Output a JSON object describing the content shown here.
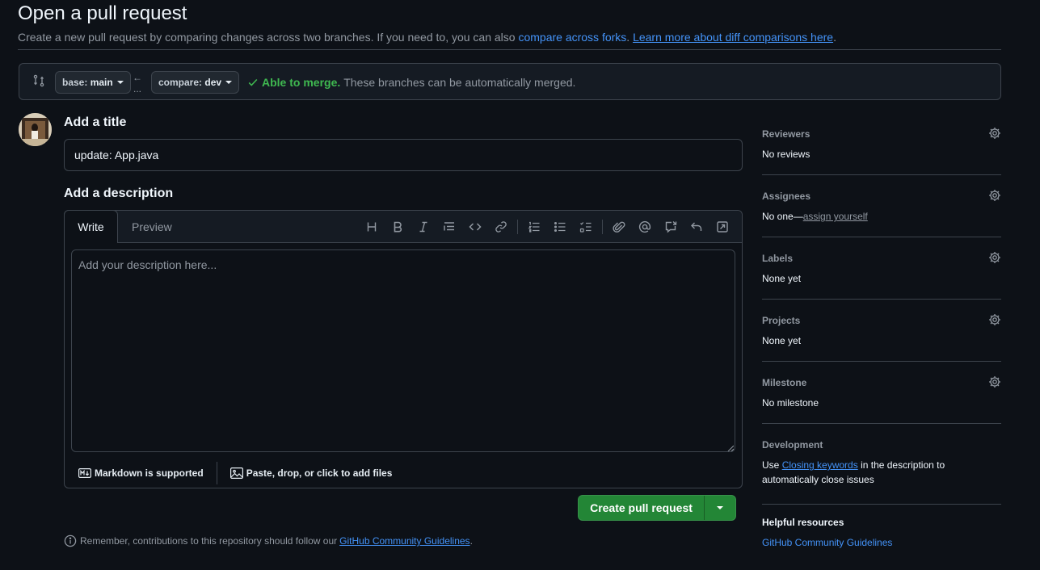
{
  "header": {
    "title": "Open a pull request",
    "subtitle_text": "Create a new pull request by comparing changes across two branches. If you need to, you can also ",
    "compare_forks_link": "compare across forks",
    "subtitle_sep": ".",
    "learn_more_link": "Learn more about diff comparisons here",
    "subtitle_end": "."
  },
  "compare": {
    "base_prefix": "base:",
    "base_branch": "main",
    "compare_prefix": "compare:",
    "compare_branch": "dev",
    "arrow_glyph": "←",
    "ellipsis": "...",
    "merge_ok": "Able to merge.",
    "merge_text": "These branches can be automatically merged."
  },
  "form": {
    "title_label": "Add a title",
    "title_value": "update: App.java",
    "description_label": "Add a description",
    "tabs": [
      "Write",
      "Preview"
    ],
    "description_placeholder": "Add your description here...",
    "markdown_note": "Markdown is supported",
    "files_note": "Paste, drop, or click to add files",
    "submit_label": "Create pull request",
    "remember_text": "Remember, contributions to this repository should follow our",
    "remember_link": "GitHub Community Guidelines",
    "remember_end": "."
  },
  "toolbar_icons": [
    "heading-icon",
    "bold-icon",
    "italic-icon",
    "quote-icon",
    "code-icon",
    "link-icon",
    "ordered-list-icon",
    "unordered-list-icon",
    "task-list-icon",
    "attach-icon",
    "mention-icon",
    "reference-icon",
    "undo-icon",
    "fullscreen-icon"
  ],
  "sidebar": {
    "reviewers": {
      "label": "Reviewers",
      "value": "No reviews"
    },
    "assignees": {
      "label": "Assignees",
      "value": "No one—",
      "action": "assign yourself"
    },
    "labels": {
      "label": "Labels",
      "value": "None yet"
    },
    "projects": {
      "label": "Projects",
      "value": "None yet"
    },
    "milestone": {
      "label": "Milestone",
      "value": "No milestone"
    },
    "development": {
      "label": "Development",
      "text_before": "Use ",
      "link": "Closing keywords",
      "text_after": " in the description to automatically close issues"
    },
    "helpful": {
      "label": "Helpful resources",
      "link": "GitHub Community Guidelines"
    }
  },
  "colors": {
    "background": "#0d1117",
    "accent_link": "#4493f8",
    "success": "#3fb950",
    "primary_button": "#238636"
  }
}
